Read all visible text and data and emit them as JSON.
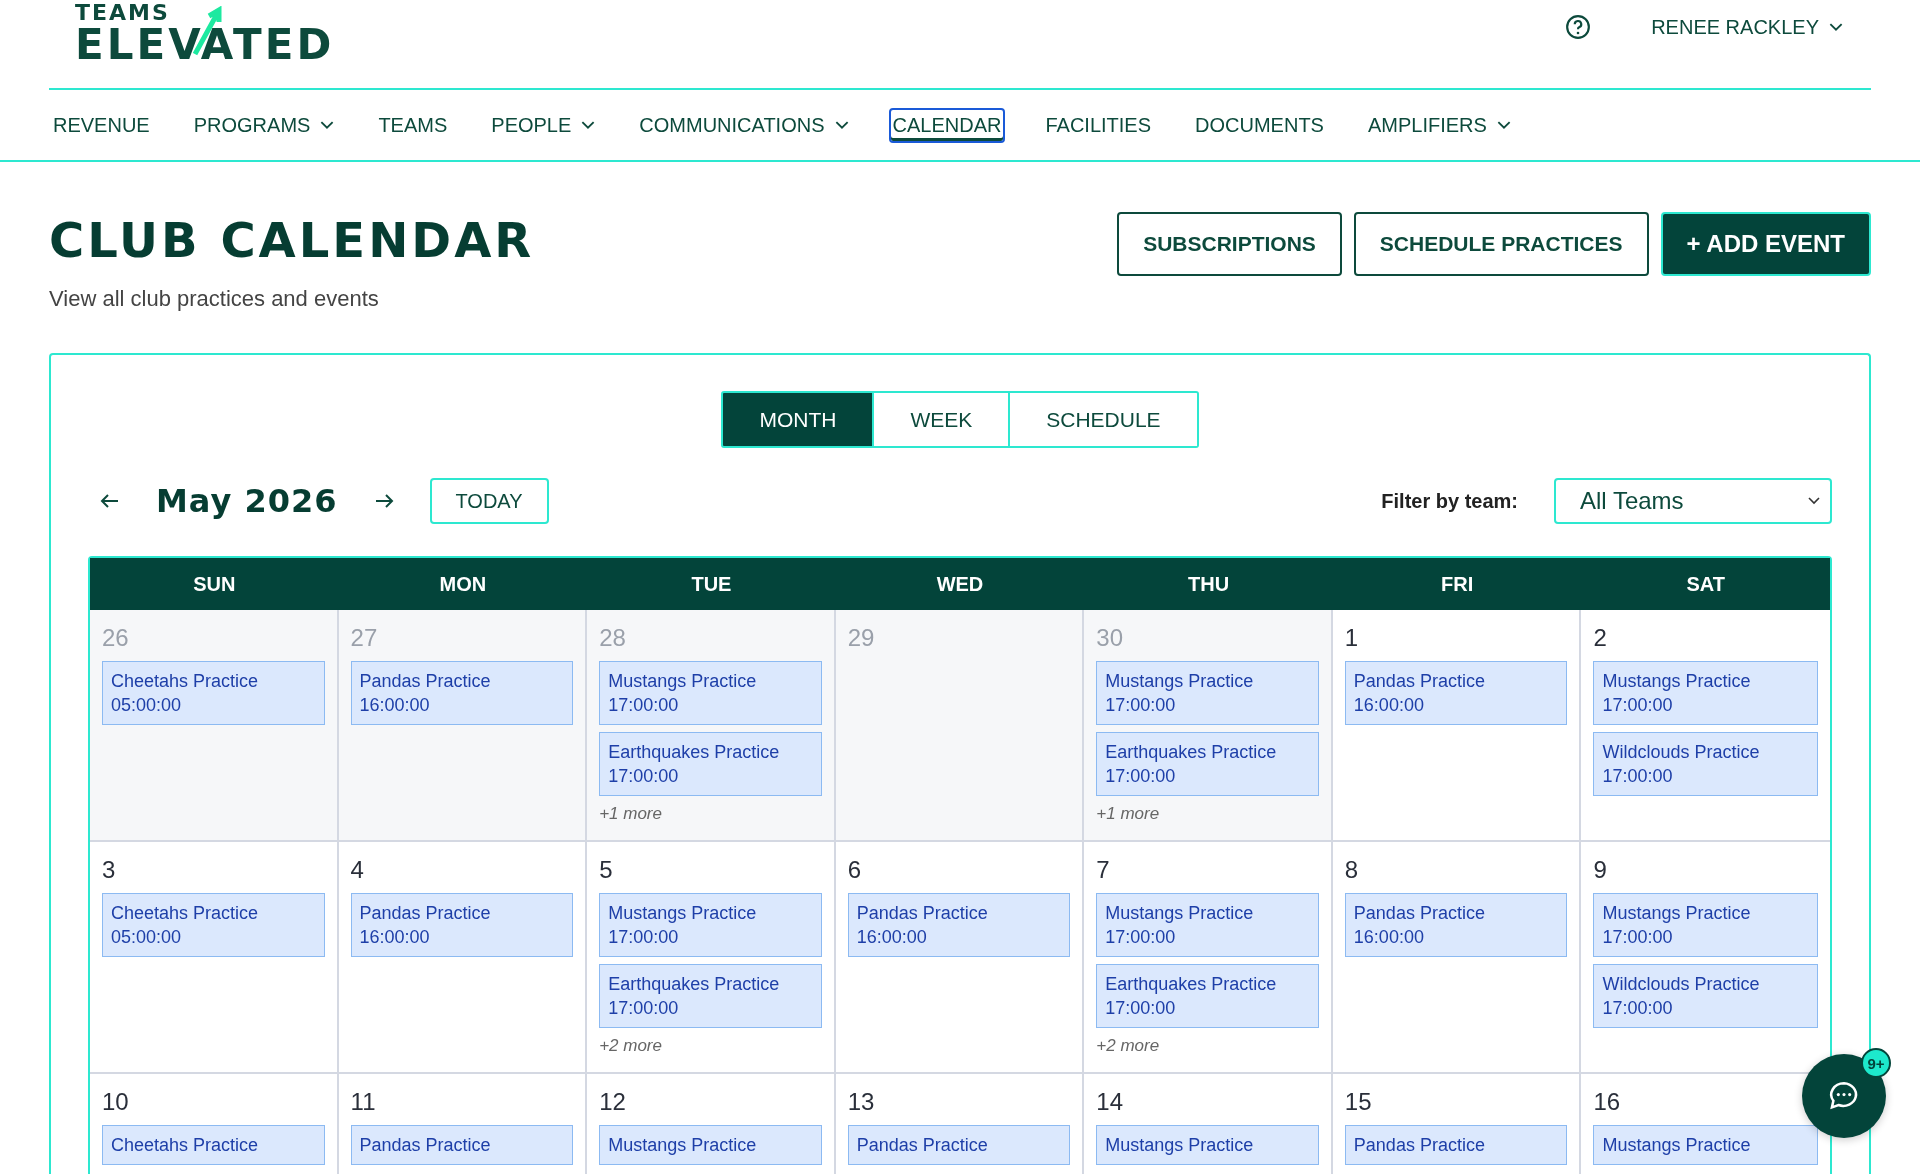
{
  "logo": {
    "top": "TEAMS",
    "bottom": "ELEVATED"
  },
  "user": {
    "name": "RENEE RACKLEY"
  },
  "nav": [
    {
      "label": "REVENUE",
      "dropdown": false,
      "selected": false
    },
    {
      "label": "PROGRAMS",
      "dropdown": true,
      "selected": false
    },
    {
      "label": "TEAMS",
      "dropdown": false,
      "selected": false
    },
    {
      "label": "PEOPLE",
      "dropdown": true,
      "selected": false
    },
    {
      "label": "COMMUNICATIONS",
      "dropdown": true,
      "selected": false
    },
    {
      "label": "CALENDAR",
      "dropdown": false,
      "selected": true
    },
    {
      "label": "FACILITIES",
      "dropdown": false,
      "selected": false
    },
    {
      "label": "DOCUMENTS",
      "dropdown": false,
      "selected": false
    },
    {
      "label": "AMPLIFIERS",
      "dropdown": true,
      "selected": false
    }
  ],
  "page": {
    "title": "CLUB CALENDAR",
    "subtitle": "View all club practices and events"
  },
  "actions": [
    {
      "label": "SUBSCRIPTIONS",
      "kind": "outline"
    },
    {
      "label": "SCHEDULE PRACTICES",
      "kind": "outline"
    },
    {
      "label": "+ ADD EVENT",
      "kind": "primary"
    }
  ],
  "views": [
    {
      "label": "MONTH",
      "selected": true
    },
    {
      "label": "WEEK",
      "selected": false
    },
    {
      "label": "SCHEDULE",
      "selected": false
    }
  ],
  "month": "May 2026",
  "today_button": "TODAY",
  "filter": {
    "label": "Filter by team:",
    "value": "All Teams"
  },
  "weekdays": [
    "SUN",
    "MON",
    "TUE",
    "WED",
    "THU",
    "FRI",
    "SAT"
  ],
  "weeks": [
    [
      {
        "day": "26",
        "outside": true,
        "events": [
          {
            "title": "Cheetahs Practice",
            "time": "05:00:00"
          }
        ]
      },
      {
        "day": "27",
        "outside": true,
        "events": [
          {
            "title": "Pandas Practice",
            "time": "16:00:00"
          }
        ]
      },
      {
        "day": "28",
        "outside": true,
        "events": [
          {
            "title": "Mustangs Practice",
            "time": "17:00:00"
          },
          {
            "title": "Earthquakes Practice",
            "time": "17:00:00"
          }
        ],
        "more": "+1 more"
      },
      {
        "day": "29",
        "outside": true
      },
      {
        "day": "30",
        "outside": true,
        "events": [
          {
            "title": "Mustangs Practice",
            "time": "17:00:00"
          },
          {
            "title": "Earthquakes Practice",
            "time": "17:00:00"
          }
        ],
        "more": "+1 more"
      },
      {
        "day": "1",
        "outside": false,
        "events": [
          {
            "title": "Pandas Practice",
            "time": "16:00:00"
          }
        ]
      },
      {
        "day": "2",
        "outside": false,
        "events": [
          {
            "title": "Mustangs Practice",
            "time": "17:00:00"
          },
          {
            "title": "Wildclouds Practice",
            "time": "17:00:00"
          }
        ]
      }
    ],
    [
      {
        "day": "3",
        "outside": false,
        "events": [
          {
            "title": "Cheetahs Practice",
            "time": "05:00:00"
          }
        ]
      },
      {
        "day": "4",
        "outside": false,
        "events": [
          {
            "title": "Pandas Practice",
            "time": "16:00:00"
          }
        ]
      },
      {
        "day": "5",
        "outside": false,
        "events": [
          {
            "title": "Mustangs Practice",
            "time": "17:00:00"
          },
          {
            "title": "Earthquakes Practice",
            "time": "17:00:00"
          }
        ],
        "more": "+2 more"
      },
      {
        "day": "6",
        "outside": false,
        "events": [
          {
            "title": "Pandas Practice",
            "time": "16:00:00"
          }
        ]
      },
      {
        "day": "7",
        "outside": false,
        "events": [
          {
            "title": "Mustangs Practice",
            "time": "17:00:00"
          },
          {
            "title": "Earthquakes Practice",
            "time": "17:00:00"
          }
        ],
        "more": "+2 more"
      },
      {
        "day": "8",
        "outside": false,
        "events": [
          {
            "title": "Pandas Practice",
            "time": "16:00:00"
          }
        ]
      },
      {
        "day": "9",
        "outside": false,
        "events": [
          {
            "title": "Mustangs Practice",
            "time": "17:00:00"
          },
          {
            "title": "Wildclouds Practice",
            "time": "17:00:00"
          }
        ]
      }
    ],
    [
      {
        "day": "10",
        "outside": false,
        "events": [
          {
            "title": "Cheetahs Practice"
          }
        ]
      },
      {
        "day": "11",
        "outside": false,
        "events": [
          {
            "title": "Pandas Practice"
          }
        ]
      },
      {
        "day": "12",
        "outside": false,
        "events": [
          {
            "title": "Mustangs Practice"
          }
        ]
      },
      {
        "day": "13",
        "outside": false,
        "events": [
          {
            "title": "Pandas Practice"
          }
        ]
      },
      {
        "day": "14",
        "outside": false,
        "events": [
          {
            "title": "Mustangs Practice"
          }
        ]
      },
      {
        "day": "15",
        "outside": false,
        "events": [
          {
            "title": "Pandas Practice"
          }
        ]
      },
      {
        "day": "16",
        "outside": false,
        "events": [
          {
            "title": "Mustangs Practice"
          }
        ]
      }
    ]
  ],
  "chat": {
    "badge": "9+"
  }
}
